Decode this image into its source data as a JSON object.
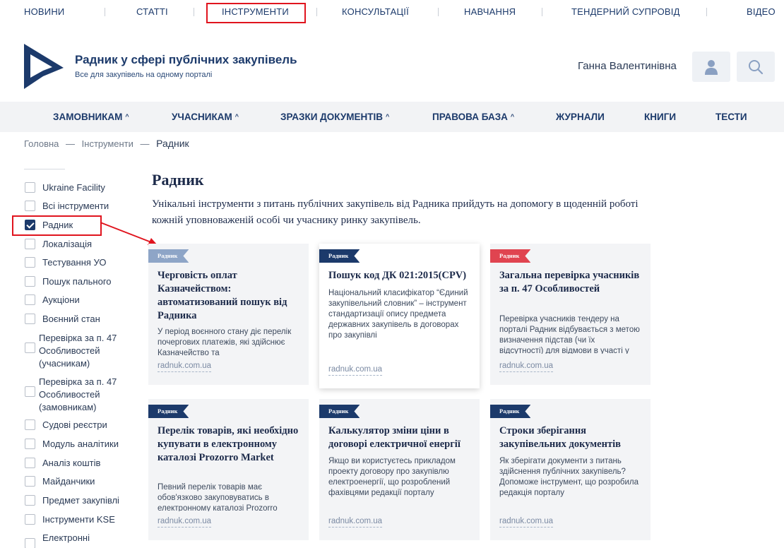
{
  "topnav": [
    "НОВИНИ",
    "СТАТТІ",
    "ІНСТРУМЕНТИ",
    "КОНСУЛЬТАЦІЇ",
    "НАВЧАННЯ",
    "ТЕНДЕРНИЙ СУПРОВІД",
    "ВІДЕО"
  ],
  "header": {
    "title": "Радник у сфері публічних закупівель",
    "subtitle": "Все для закупівель на одному порталі",
    "username": "Ганна Валентинівна"
  },
  "mainnav": [
    "ЗАМОВНИКАМ",
    "УЧАСНИКАМ",
    "ЗРАЗКИ ДОКУМЕНТІВ",
    "ПРАВОВА БАЗА",
    "ЖУРНАЛИ",
    "КНИГИ",
    "ТЕСТИ"
  ],
  "breadcrumb": [
    "Головна",
    "Інструменти",
    "Радник"
  ],
  "filters": [
    {
      "label": "Ukraine Facility",
      "checked": false
    },
    {
      "label": "Всі інструменти",
      "checked": false
    },
    {
      "label": "Радник",
      "checked": true
    },
    {
      "label": "Локалізація",
      "checked": false
    },
    {
      "label": "Тестування УО",
      "checked": false
    },
    {
      "label": "Пошук пального",
      "checked": false
    },
    {
      "label": "Аукціони",
      "checked": false
    },
    {
      "label": "Воєнний стан",
      "checked": false
    },
    {
      "label": "Перевірка за п. 47 Особливостей (учасникам)",
      "checked": false
    },
    {
      "label": "Перевірка за п. 47 Особливостей (замовникам)",
      "checked": false
    },
    {
      "label": "Судові реєстри",
      "checked": false
    },
    {
      "label": "Модуль аналітики",
      "checked": false
    },
    {
      "label": "Аналіз коштів",
      "checked": false
    },
    {
      "label": "Майданчики",
      "checked": false
    },
    {
      "label": "Предмет закупівлі",
      "checked": false
    },
    {
      "label": "Інструменти KSE",
      "checked": false
    },
    {
      "label": "Електронні",
      "checked": false
    }
  ],
  "content": {
    "title": "Радник",
    "lead": "Унікальні інструменти з питань публічних закупівель від Радника прийдуть на допомогу в щоденній роботі кожній уповноваженій особі чи учаснику ринку закупівель."
  },
  "cards": [
    {
      "tag": "Радник",
      "title": "Черговість оплат Казначейством: автоматизований пошук від Радника",
      "desc": "У період воєнного стану діє перелік почергових платежів, які здійснює Казначейство та",
      "link": "radnuk.com.ua"
    },
    {
      "tag": "Радник",
      "title": "Пошук код ДК 021:2015(CPV)",
      "desc": "Національний класифікатор “Єдиний закупівельний словник” – інструмент стандартизації опису предмета державних закупівель в договорах про закупівлі",
      "link": "radnuk.com.ua"
    },
    {
      "tag": "Радник",
      "title": "Загальна перевірка учасників за п. 47 Особливостей",
      "desc": "Перевірка учасників тендеру на порталі Радник відбувається з метою визначення підстав (чи їх відсутності) для відмови в участі у",
      "link": "radnuk.com.ua"
    },
    {
      "tag": "Радник",
      "title": "Перелік товарів, які необхідно купувати в електронному каталозі Prozorro Market",
      "desc": "Певний перелік товарів має обов'язково закуповуватись в електронному каталозі Prozorro",
      "link": "radnuk.com.ua"
    },
    {
      "tag": "Радник",
      "title": "Калькулятор зміни ціни в договорі електричної енергії",
      "desc": "Якщо ви користуєтесь прикладом проекту договору про закупівлю електроенергії, що розроблений фахівцями редакції порталу",
      "link": "radnuk.com.ua"
    },
    {
      "tag": "Радник",
      "title": "Строки зберігання закупівельних документів",
      "desc": "Як зберігати документи з питань здійснення публічних закупівель? Допоможе інструмент, що розробила редакція порталу",
      "link": "radnuk.com.ua"
    }
  ],
  "colors": {
    "brand": "#1c3a6b",
    "highlight": "#e0141e"
  }
}
